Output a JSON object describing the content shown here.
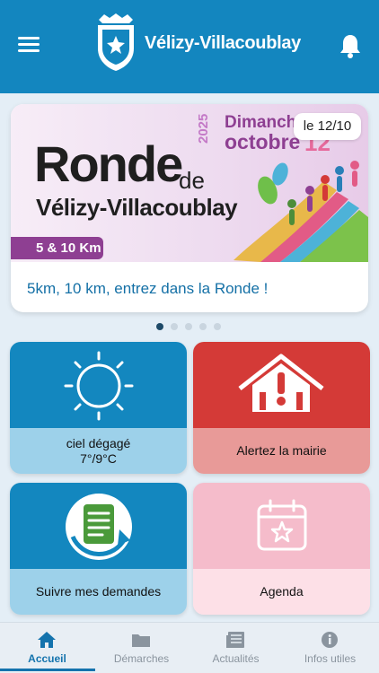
{
  "header": {
    "title": "Vélizy-Villacoublay",
    "menu_icon": "hamburger-menu-icon",
    "logo_icon": "city-crest-logo",
    "bell_icon": "bell-icon"
  },
  "carousel": {
    "banner": {
      "title_line1": "Ronde",
      "title_de": "de",
      "title_line2": "Vélizy-Villacoublay",
      "distances": "5 & 10 Km",
      "day": "Dimanche",
      "month": "octobre",
      "day_number": "12",
      "year": "2025"
    },
    "date_badge": "le 12/10",
    "caption": "5km, 10 km, entrez dans la Ronde !",
    "pages": 5,
    "active_page": 1
  },
  "tiles": [
    {
      "label": "ciel dégagé\n7°/9°C",
      "line1": "ciel dégagé",
      "line2": "7°/9°C",
      "icon": "sun-icon"
    },
    {
      "label": "Alertez la mairie",
      "icon": "alert-building-icon"
    },
    {
      "label": "Suivre mes demandes",
      "icon": "document-refresh-icon"
    },
    {
      "label": "Agenda",
      "icon": "calendar-star-icon"
    }
  ],
  "tabbar": {
    "tabs": [
      {
        "label": "Accueil",
        "icon": "home-icon",
        "active": true
      },
      {
        "label": "Démarches",
        "icon": "folder-icon",
        "active": false
      },
      {
        "label": "Actualités",
        "icon": "newspaper-icon",
        "active": false
      },
      {
        "label": "Infos utiles",
        "icon": "info-icon",
        "active": false
      }
    ]
  },
  "colors": {
    "header_blue": "#1386bf",
    "alert_red": "#d43a37",
    "agenda_pink": "#f5bccb",
    "accent_purple": "#8e3f92",
    "active_tab": "#1473ad"
  }
}
